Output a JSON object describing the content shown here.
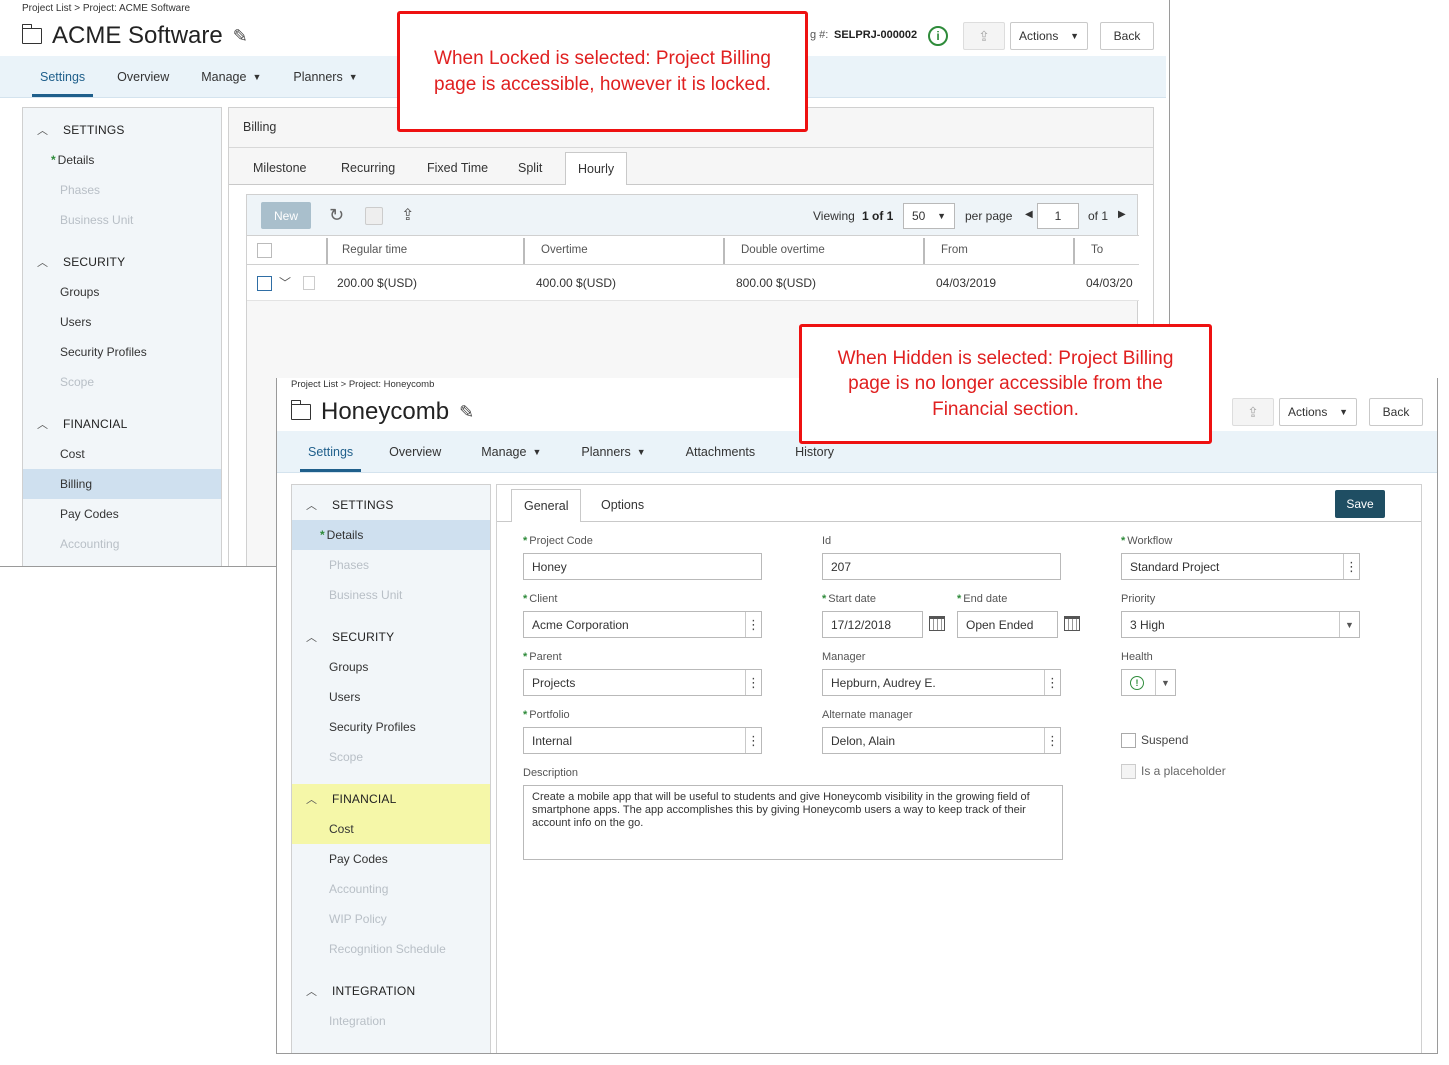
{
  "winA": {
    "breadcrumb": "Project List > Project: ACME Software",
    "title": "ACME Software",
    "project_num_label": "g #:",
    "project_num": "SELPRJ-000002",
    "actions_label": "Actions",
    "back_label": "Back",
    "nav": [
      {
        "label": "Settings"
      },
      {
        "label": "Overview"
      },
      {
        "label": "Manage"
      },
      {
        "label": "Planners"
      }
    ],
    "sidebar": {
      "settings": "SETTINGS",
      "details": "Details",
      "phases": "Phases",
      "business_unit": "Business Unit",
      "security": "SECURITY",
      "groups": "Groups",
      "users": "Users",
      "security_profiles": "Security Profiles",
      "scope": "Scope",
      "financial": "FINANCIAL",
      "cost": "Cost",
      "billing": "Billing",
      "pay_codes": "Pay Codes",
      "accounting": "Accounting"
    },
    "panel_title": "Billing",
    "tabs": [
      "Milestone",
      "Recurring",
      "Fixed Time",
      "Split",
      "Hourly"
    ],
    "toolbar": {
      "new_label": "New",
      "viewing": "Viewing",
      "viewing_range": "1 of 1",
      "per_page_value": "50",
      "per_page_label": "per page",
      "page_value": "1",
      "of_pages": "of 1"
    },
    "grid": {
      "columns": [
        "Regular time",
        "Overtime",
        "Double overtime",
        "From",
        "To"
      ],
      "row": [
        "200.00 $(USD)",
        "400.00 $(USD)",
        "800.00 $(USD)",
        "04/03/2019",
        "04/03/20"
      ]
    }
  },
  "callout_locked": {
    "line1": "When Locked is selected: Project Billing",
    "line2": "page is accessible, however it is locked."
  },
  "callout_hidden": {
    "line1": "When Hidden is selected: Project Billing",
    "line2": "page is no longer accessible from the",
    "line3": "Financial section."
  },
  "winB": {
    "breadcrumb": "Project List > Project: Honeycomb",
    "title": "Honeycomb",
    "actions_label": "Actions",
    "back_label": "Back",
    "nav": [
      {
        "label": "Settings"
      },
      {
        "label": "Overview"
      },
      {
        "label": "Manage"
      },
      {
        "label": "Planners"
      },
      {
        "label": "Attachments"
      },
      {
        "label": "History"
      }
    ],
    "sidebar": {
      "settings": "SETTINGS",
      "details": "Details",
      "phases": "Phases",
      "business_unit": "Business Unit",
      "security": "SECURITY",
      "groups": "Groups",
      "users": "Users",
      "security_profiles": "Security Profiles",
      "scope": "Scope",
      "financial": "FINANCIAL",
      "cost": "Cost",
      "pay_codes": "Pay Codes",
      "accounting": "Accounting",
      "wip_policy": "WIP Policy",
      "recognition_schedule": "Recognition Schedule",
      "integration": "INTEGRATION",
      "integration_item": "Integration"
    },
    "tabs": [
      "General",
      "Options"
    ],
    "save_label": "Save",
    "form": {
      "project_code_label": "Project Code",
      "project_code": "Honey",
      "id_label": "Id",
      "id": "207",
      "workflow_label": "Workflow",
      "workflow": "Standard Project",
      "client_label": "Client",
      "client": "Acme Corporation",
      "start_date_label": "Start date",
      "start_date": "17/12/2018",
      "end_date_label": "End date",
      "end_date": "Open Ended",
      "priority_label": "Priority",
      "priority": "3 High",
      "parent_label": "Parent",
      "parent": "Projects",
      "manager_label": "Manager",
      "manager": "Hepburn, Audrey E.",
      "health_label": "Health",
      "portfolio_label": "Portfolio",
      "portfolio": "Internal",
      "alt_manager_label": "Alternate manager",
      "alt_manager": "Delon, Alain",
      "suspend_label": "Suspend",
      "placeholder_label": "Is a placeholder",
      "description_label": "Description",
      "description": "Create a mobile app that will be useful to students and give Honeycomb visibility in the growing field of smartphone apps. The app accomplishes this by giving Honeycomb users a way to keep track of their account info on the go."
    }
  },
  "colors": {
    "accent": "#1f5f8b",
    "save": "#1f4e63",
    "callout": "#e02020",
    "highlight": "#f5f7a8"
  }
}
